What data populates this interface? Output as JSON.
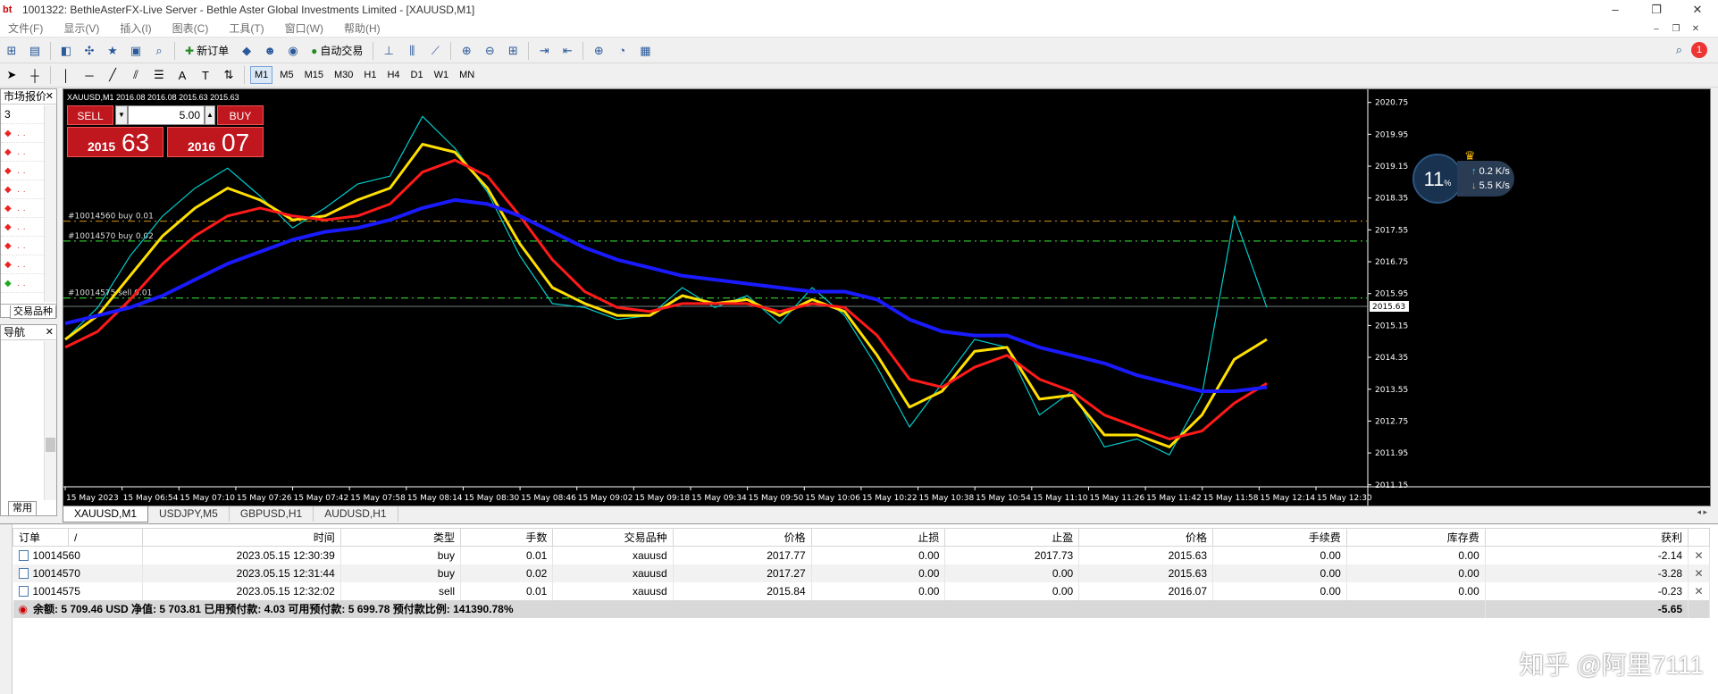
{
  "window": {
    "logo": "bt",
    "title": "1001322: BethleAsterFX-Live Server - Bethle Aster Global Investments Limited - [XAUUSD,M1]",
    "controls": [
      "–",
      "❐",
      "✕"
    ]
  },
  "menu": {
    "items": [
      "文件(F)",
      "显示(V)",
      "插入(I)",
      "图表(C)",
      "工具(T)",
      "窗口(W)",
      "帮助(H)"
    ],
    "mdi_controls": [
      "–",
      "❐",
      "✕"
    ]
  },
  "toolbar": {
    "new_order_label": "新订单",
    "auto_trade_label": "自动交易",
    "timeframes": [
      "M1",
      "M5",
      "M15",
      "M30",
      "H1",
      "H4",
      "D1",
      "W1",
      "MN"
    ],
    "active_timeframe": "M1",
    "alert_count": "1"
  },
  "market_watch": {
    "title": "市场报价",
    "first_row": "3",
    "tab_symbols": "交易品种"
  },
  "navigator": {
    "title": "导航",
    "tab_common": "常用"
  },
  "chart": {
    "header": "XAUUSD,M1  2016.08 2016.08 2015.63 2015.63",
    "symbol": "XAUUSD",
    "current_price_label": "2015.63",
    "order_lines": [
      {
        "label": "#10014560 buy 0.01",
        "price": 2017.77,
        "color": "#b8860b"
      },
      {
        "label": "#10014570 buy 0.02",
        "price": 2017.27,
        "color": "#2fbf2f"
      },
      {
        "label": "#10014575 sell 0.01",
        "price": 2015.84,
        "color": "#2fbf2f"
      }
    ]
  },
  "one_click": {
    "sell_label": "SELL",
    "buy_label": "BUY",
    "lot": "5.00",
    "sell_small": "2015",
    "sell_big": "63",
    "buy_small": "2016",
    "buy_big": "07"
  },
  "speed_widget": {
    "percent": "11",
    "percent_unit": "%",
    "up": "0.2",
    "down": "5.5",
    "unit": "K/s"
  },
  "chart_data": {
    "type": "line",
    "ylim": [
      2011.1,
      2020.9
    ],
    "y_ticks": [
      "2020.75",
      "2019.95",
      "2019.15",
      "2018.35",
      "2017.55",
      "2016.75",
      "2015.95",
      "2015.15",
      "2014.35",
      "2013.55",
      "2012.75",
      "2011.95",
      "2011.15"
    ],
    "x_ticks": [
      "15 May 2023",
      "15 May 06:54",
      "15 May 07:10",
      "15 May 07:26",
      "15 May 07:42",
      "15 May 07:58",
      "15 May 08:14",
      "15 May 08:30",
      "15 May 08:46",
      "15 May 09:02",
      "15 May 09:18",
      "15 May 09:34",
      "15 May 09:50",
      "15 May 10:06",
      "15 May 10:22",
      "15 May 10:38",
      "15 May 10:54",
      "15 May 11:10",
      "15 May 11:26",
      "15 May 11:42",
      "15 May 11:58",
      "15 May 12:14",
      "15 May 12:30"
    ],
    "series": [
      {
        "color": "#00cccc",
        "values": [
          2014.8,
          2015.6,
          2016.9,
          2017.9,
          2018.6,
          2019.1,
          2018.4,
          2017.6,
          2018.1,
          2018.7,
          2018.9,
          2020.4,
          2019.6,
          2018.5,
          2016.9,
          2015.7,
          2015.6,
          2015.3,
          2015.4,
          2016.1,
          2015.6,
          2015.9,
          2015.2,
          2016.1,
          2015.4,
          2014.1,
          2012.6,
          2013.7,
          2014.8,
          2014.6,
          2012.9,
          2013.5,
          2012.1,
          2012.3,
          2011.9,
          2013.4,
          2017.9,
          2015.6
        ]
      },
      {
        "color": "#ffe000",
        "values": [
          2014.8,
          2015.4,
          2016.4,
          2017.4,
          2018.1,
          2018.6,
          2018.3,
          2017.8,
          2017.9,
          2018.3,
          2018.6,
          2019.7,
          2019.5,
          2018.6,
          2017.2,
          2016.1,
          2015.7,
          2015.4,
          2015.4,
          2015.9,
          2015.7,
          2015.8,
          2015.4,
          2015.8,
          2015.5,
          2014.4,
          2013.1,
          2013.5,
          2014.5,
          2014.6,
          2013.3,
          2013.4,
          2012.4,
          2012.4,
          2012.1,
          2012.9,
          2014.3,
          2014.8
        ]
      },
      {
        "color": "#ff1a1a",
        "values": [
          2014.6,
          2015.0,
          2015.8,
          2016.7,
          2017.4,
          2017.9,
          2018.1,
          2017.9,
          2017.8,
          2017.9,
          2018.2,
          2019.0,
          2019.3,
          2018.9,
          2017.9,
          2016.8,
          2016.0,
          2015.6,
          2015.5,
          2015.7,
          2015.7,
          2015.7,
          2015.5,
          2015.7,
          2015.6,
          2014.9,
          2013.8,
          2013.6,
          2014.1,
          2014.4,
          2013.8,
          2013.5,
          2012.9,
          2012.6,
          2012.3,
          2012.5,
          2013.2,
          2013.7
        ]
      },
      {
        "color": "#1a1aff",
        "values": [
          2015.2,
          2015.4,
          2015.6,
          2015.9,
          2016.3,
          2016.7,
          2017.0,
          2017.3,
          2017.5,
          2017.6,
          2017.8,
          2018.1,
          2018.3,
          2018.2,
          2017.9,
          2017.5,
          2017.1,
          2016.8,
          2016.6,
          2016.4,
          2016.3,
          2016.2,
          2016.1,
          2016.0,
          2016.0,
          2015.8,
          2015.3,
          2015.0,
          2014.9,
          2014.9,
          2014.6,
          2014.4,
          2014.2,
          2013.9,
          2013.7,
          2013.5,
          2013.5,
          2013.6
        ]
      }
    ],
    "price_line": 2015.63,
    "grid": false
  },
  "chart_tabs": [
    "XAUUSD,M1",
    "USDJPY,M5",
    "GBPUSD,H1",
    "AUDUSD,H1"
  ],
  "chart_tab_arrows": "◂ ▸",
  "terminal": {
    "headers": [
      "订单",
      "/",
      "时间",
      "类型",
      "手数",
      "交易品种",
      "价格",
      "止损",
      "止盈",
      "价格",
      "手续费",
      "库存费",
      "获利"
    ],
    "rows": [
      {
        "order": "10014560",
        "time": "2023.05.15 12:30:39",
        "type": "buy",
        "lots": "0.01",
        "symbol": "xauusd",
        "open": "2017.77",
        "sl": "0.00",
        "tp": "2017.73",
        "price": "2015.63",
        "commission": "0.00",
        "swap": "0.00",
        "profit": "-2.14"
      },
      {
        "order": "10014570",
        "time": "2023.05.15 12:31:44",
        "type": "buy",
        "lots": "0.02",
        "symbol": "xauusd",
        "open": "2017.27",
        "sl": "0.00",
        "tp": "0.00",
        "price": "2015.63",
        "commission": "0.00",
        "swap": "0.00",
        "profit": "-3.28"
      },
      {
        "order": "10014575",
        "time": "2023.05.15 12:32:02",
        "type": "sell",
        "lots": "0.01",
        "symbol": "xauusd",
        "open": "2015.84",
        "sl": "0.00",
        "tp": "0.00",
        "price": "2016.07",
        "commission": "0.00",
        "swap": "0.00",
        "profit": "-0.23"
      }
    ],
    "summary": "余额: 5 709.46 USD  净值: 5 703.81  已用预付款: 4.03  可用预付款: 5 699.78  预付款比例: 141390.78%",
    "total_profit": "-5.65"
  },
  "watermark": "知乎 @阿里7111"
}
